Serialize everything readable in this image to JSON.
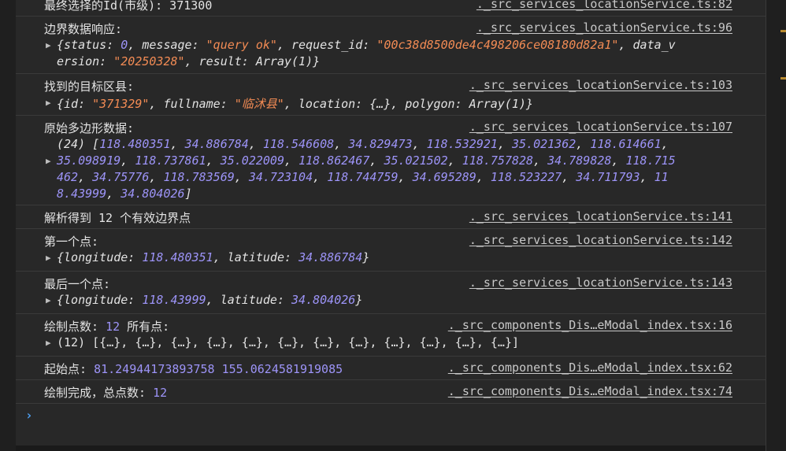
{
  "logs": [
    {
      "msg": "最终选择的Id(市级): 371300",
      "source": "._src_services_locationService.ts:82"
    },
    {
      "msg": "边界数据响应:",
      "source": "._src_services_locationService.ts:96",
      "detail_line1_pre": "{status: ",
      "detail_status": "0",
      "detail_msg_key": ", message: ",
      "detail_msg": "\"query ok\"",
      "detail_req_key": ", request_id: ",
      "detail_req": "\"00c38d8500de4c498206ce08180d82a1\"",
      "detail_dv_key": ", data_v",
      "detail_line2_pre": "ersion: ",
      "detail_dv": "\"20250328\"",
      "detail_line2_post": ", result: Array(1)}"
    },
    {
      "msg": "找到的目标区县:",
      "source": "._src_services_locationService.ts:103",
      "detail_pre": "{id: ",
      "detail_id": "\"371329\"",
      "detail_mid": ", fullname: ",
      "detail_name": "\"临沭县\"",
      "detail_post": ", location: {…}, polygon: Array(1)}"
    },
    {
      "msg": "原始多边形数据:",
      "source": "._src_services_locationService.ts:107",
      "count": "(24) [",
      "row1": [
        "118.480351",
        "34.886784",
        "118.546608",
        "34.829473",
        "118.532921",
        "35.021362",
        "118.614661"
      ],
      "row2": [
        "35.098919",
        "118.737861",
        "35.022009",
        "118.862467",
        "35.021502",
        "118.757828",
        "34.789828",
        "118.715"
      ],
      "row3": [
        "462",
        "34.75776",
        "118.783569",
        "34.723104",
        "118.744759",
        "34.695289",
        "118.523227",
        "34.711793",
        "11"
      ],
      "row4": [
        "8.43999",
        "34.804026"
      ]
    },
    {
      "msg_pre": "解析得到 ",
      "msg_num": "12",
      "msg_post": " 个有效边界点",
      "source": "._src_services_locationService.ts:141"
    },
    {
      "msg": "第一个点:",
      "source": "._src_services_locationService.ts:142",
      "detail_pre": "{longitude: ",
      "lon": "118.480351",
      "detail_mid": ", latitude: ",
      "lat": "34.886784",
      "detail_post": "}"
    },
    {
      "msg": "最后一个点:",
      "source": "._src_services_locationService.ts:143",
      "detail_pre": "{longitude: ",
      "lon": "118.43999",
      "detail_mid": ", latitude: ",
      "lat": "34.804026",
      "detail_post": "}"
    },
    {
      "msg_pre": "绘制点数: ",
      "msg_num": "12",
      "msg_post": " 所有点:",
      "source": "._src_components_Dis…eModal_index.tsx:16",
      "detail": "(12) [{…}, {…}, {…}, {…}, {…}, {…}, {…}, {…}, {…}, {…}, {…}, {…}]"
    },
    {
      "msg_pre": "起始点: ",
      "msg_num": "81.24944173893758 155.0624581919085",
      "source": "._src_components_Dis…eModal_index.tsx:62"
    },
    {
      "msg_pre": "绘制完成，总点数: ",
      "msg_num": "12",
      "source": "._src_components_Dis…eModal_index.tsx:74"
    }
  ],
  "prompt_symbol": "›",
  "expand_icon": "triangle-right-icon"
}
